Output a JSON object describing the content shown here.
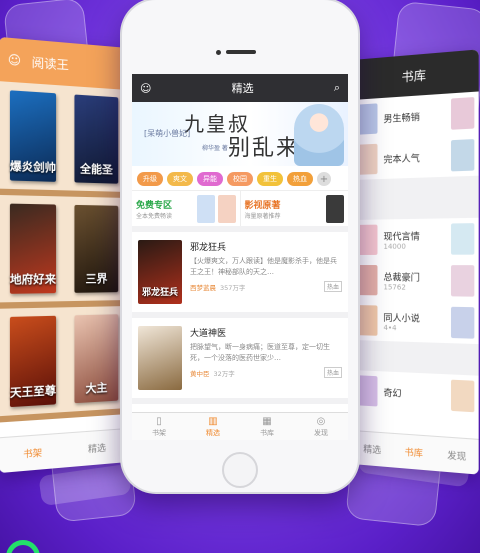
{
  "left_panel": {
    "title": "阅读王",
    "books": [
      "爆炎剑帅",
      "全能圣",
      "地府好来",
      "三界",
      "天王至尊",
      "大主"
    ],
    "tabs": [
      "书架",
      "精选"
    ]
  },
  "right_panel": {
    "title": "书库",
    "rows": [
      {
        "label": "男生畅销"
      },
      {
        "label": "完本人气"
      },
      {
        "label": "现代言情",
        "count": "14000"
      },
      {
        "label": "总裁豪门",
        "count": "15762"
      },
      {
        "label": "同人小说",
        "count": "4•4"
      },
      {
        "label": "奇幻"
      }
    ],
    "tabs": [
      "精选",
      "书库",
      "发现"
    ]
  },
  "phone": {
    "header": {
      "title": "精选"
    },
    "banner": {
      "line1": "九皇叔",
      "line2": "别乱来",
      "bracket": "[呆萌小兽妃]",
      "author": "柳华盈 著"
    },
    "tags": [
      {
        "label": "升级",
        "color": "#f29a4a"
      },
      {
        "label": "爽文",
        "color": "#f3b94a"
      },
      {
        "label": "异能",
        "color": "#e06ad0"
      },
      {
        "label": "校园",
        "color": "#f59a62"
      },
      {
        "label": "重生",
        "color": "#f2c23a"
      },
      {
        "label": "热血",
        "color": "#f2a03a"
      }
    ],
    "promos": [
      {
        "title": "免费专区",
        "sub": "全本免费畅读",
        "color": "#2aa84a"
      },
      {
        "title": "影视原著",
        "sub": "海量原著推荐",
        "color": "#e8772a"
      }
    ],
    "books": [
      {
        "title": "邪龙狂兵",
        "desc": "【火爆爽文，万人跟读】他是魔影杀手，他是兵王之王！神秘部队的天之…",
        "author": "西梦蓝晨",
        "words": "357万字",
        "badge": "热血",
        "cover_text": "邪龙狂兵"
      },
      {
        "title": "大道神医",
        "desc": "把脉望气，断一身病痛；医道至尊，定一切生死，一个没落的医药世家少…",
        "author": "黄中臣",
        "words": "32万字",
        "badge": "热血"
      }
    ],
    "tabbar": [
      {
        "label": "书架",
        "icon": "▯"
      },
      {
        "label": "精选",
        "icon": "▥",
        "active": true
      },
      {
        "label": "书库",
        "icon": "▦"
      },
      {
        "label": "发现",
        "icon": "◎"
      }
    ]
  }
}
